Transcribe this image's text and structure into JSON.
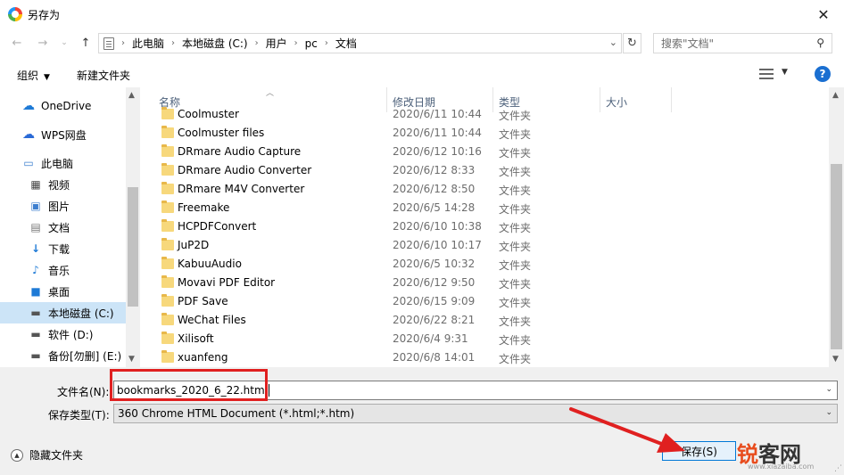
{
  "window": {
    "title": "另存为",
    "close": "✕"
  },
  "address": {
    "crumbs": [
      "此电脑",
      "本地磁盘 (C:)",
      "用户",
      "pc",
      "文档"
    ],
    "search_placeholder": "搜索\"文档\""
  },
  "toolbar": {
    "organize": "组织",
    "new_folder": "新建文件夹",
    "help": "?"
  },
  "nav": {
    "items": [
      {
        "label": "OneDrive",
        "icon": "cloud-icon"
      },
      {
        "label": "WPS网盘",
        "icon": "wps-cloud-icon"
      },
      {
        "label": "此电脑",
        "icon": "computer-icon"
      },
      {
        "label": "视频",
        "icon": "video-icon"
      },
      {
        "label": "图片",
        "icon": "picture-icon"
      },
      {
        "label": "文档",
        "icon": "document-icon"
      },
      {
        "label": "下载",
        "icon": "download-icon"
      },
      {
        "label": "音乐",
        "icon": "music-icon"
      },
      {
        "label": "桌面",
        "icon": "desktop-icon"
      },
      {
        "label": "本地磁盘 (C:)",
        "icon": "drive-c-icon"
      },
      {
        "label": "软件 (D:)",
        "icon": "drive-icon"
      },
      {
        "label": "备份[勿删] (E:)",
        "icon": "drive-icon"
      }
    ],
    "selected_index": 9
  },
  "columns": {
    "name": "名称",
    "date": "修改日期",
    "type": "类型",
    "size": "大小"
  },
  "files": [
    {
      "name": "Coolmuster",
      "date": "2020/6/11 10:44",
      "type": "文件夹"
    },
    {
      "name": "Coolmuster files",
      "date": "2020/6/11 10:44",
      "type": "文件夹"
    },
    {
      "name": "DRmare Audio Capture",
      "date": "2020/6/12 10:16",
      "type": "文件夹"
    },
    {
      "name": "DRmare Audio Converter",
      "date": "2020/6/12 8:33",
      "type": "文件夹"
    },
    {
      "name": "DRmare M4V Converter",
      "date": "2020/6/12 8:50",
      "type": "文件夹"
    },
    {
      "name": "Freemake",
      "date": "2020/6/5 14:28",
      "type": "文件夹"
    },
    {
      "name": "HCPDFConvert",
      "date": "2020/6/10 10:38",
      "type": "文件夹"
    },
    {
      "name": "JuP2D",
      "date": "2020/6/10 10:17",
      "type": "文件夹"
    },
    {
      "name": "KabuuAudio",
      "date": "2020/6/5 10:32",
      "type": "文件夹"
    },
    {
      "name": "Movavi PDF Editor",
      "date": "2020/6/12 9:50",
      "type": "文件夹"
    },
    {
      "name": "PDF Save",
      "date": "2020/6/15 9:09",
      "type": "文件夹"
    },
    {
      "name": "WeChat Files",
      "date": "2020/6/22 8:21",
      "type": "文件夹"
    },
    {
      "name": "Xilisoft",
      "date": "2020/6/4 9:31",
      "type": "文件夹"
    },
    {
      "name": "xuanfeng",
      "date": "2020/6/8 14:01",
      "type": "文件夹"
    }
  ],
  "form": {
    "filename_label": "文件名(N):",
    "filename_value": "bookmarks_2020_6_22.html",
    "filetype_label": "保存类型(T):",
    "filetype_value": "360 Chrome HTML Document (*.html;*.htm)",
    "hide_folders": "隐藏文件夹",
    "save": "保存(S)"
  },
  "watermark": {
    "text_a": "锐",
    "text_b": "客网",
    "url": "www.xiazaiba.com"
  },
  "colors": {
    "accent": "#0078d7",
    "highlight": "#e02020",
    "selected": "#cce4f7"
  }
}
